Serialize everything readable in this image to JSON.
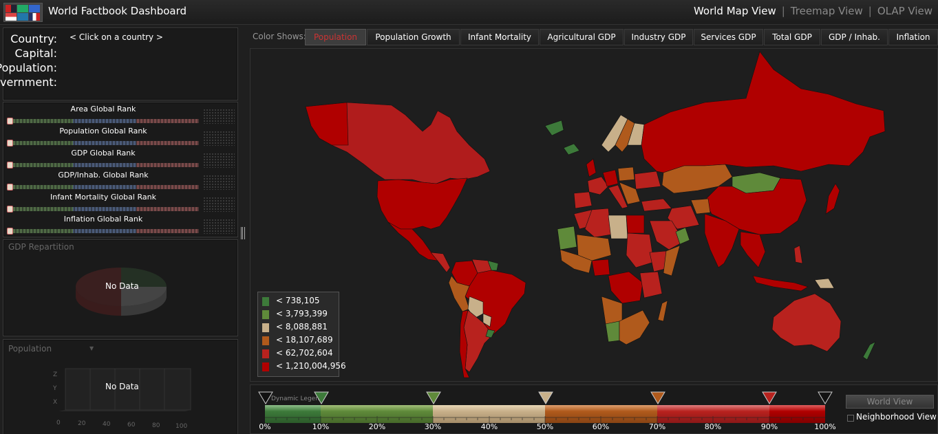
{
  "header": {
    "title": "World Factbook Dashboard",
    "views": [
      "World Map View",
      "Treemap View",
      "OLAP View"
    ],
    "separator": "|"
  },
  "country_info": {
    "labels": [
      "Country:",
      "Capital:",
      "Population:",
      "Government:"
    ],
    "country_value": "< Click on a country >"
  },
  "ranks": [
    "Area Global Rank",
    "Population Global Rank",
    "GDP Global Rank",
    "GDP/Inhab. Global Rank",
    "Infant Mortality Global Rank",
    "Inflation Global Rank"
  ],
  "gdp_panel": {
    "title": "GDP Repartition",
    "no_data": "No Data"
  },
  "pop_panel": {
    "title": "Population",
    "no_data": "No Data",
    "axis_z": "Z",
    "axis_y": "Y",
    "axis_x": "X",
    "ticks": [
      "0",
      "20",
      "40",
      "60",
      "80",
      "100"
    ]
  },
  "color_shows": {
    "label": "Color Shows:",
    "tabs": [
      "Population",
      "Population Growth",
      "Infant Mortality",
      "Agricultural GDP",
      "Industry GDP",
      "Services GDP",
      "Total GDP",
      "GDP / Inhab.",
      "Inflation"
    ],
    "selected_index": 0
  },
  "legend": {
    "items": [
      {
        "label": "< 738,105",
        "color": "#3d7a3a"
      },
      {
        "label": "< 3,793,399",
        "color": "#5f8a3a"
      },
      {
        "label": "< 8,088,881",
        "color": "#c8b08a"
      },
      {
        "label": "< 18,107,689",
        "color": "#b05a1c"
      },
      {
        "label": "< 62,702,604",
        "color": "#b8221e"
      },
      {
        "label": "< 1,210,004,956",
        "color": "#b00000"
      }
    ]
  },
  "dynamic_legend": {
    "title": "Dynamic Legend",
    "ticks": [
      "0%",
      "10%",
      "20%",
      "30%",
      "40%",
      "50%",
      "60%",
      "70%",
      "80%",
      "90%",
      "100%"
    ],
    "world_view_button": "World View",
    "neighborhood_label": "Neighborhood View",
    "neighborhood_checked": false
  },
  "colors": {
    "background": "#1f1f1f",
    "accent_red": "#b00000",
    "selected_tab_text": "#cc3333"
  }
}
